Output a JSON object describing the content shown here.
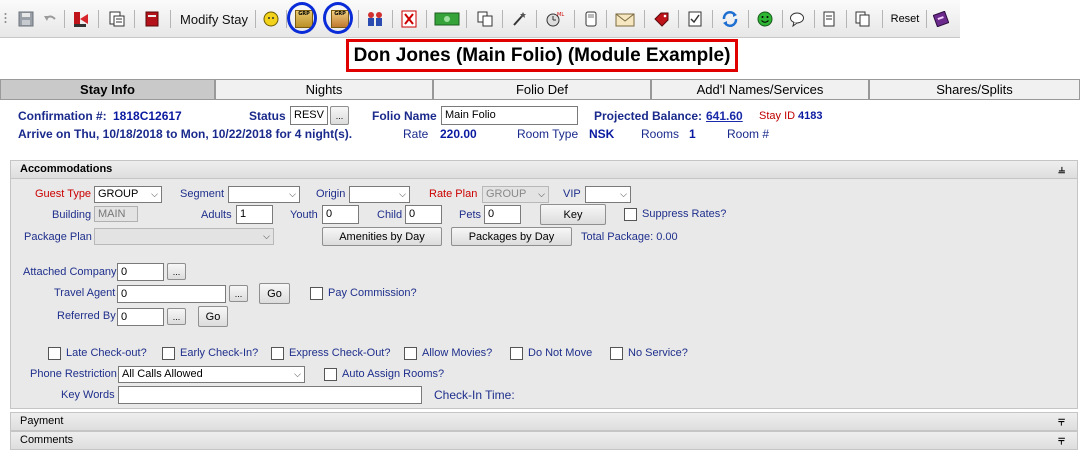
{
  "toolbar": {
    "modify_stay_label": "Modify Stay",
    "grp1_text": "GRP",
    "grp2_text": "GRP",
    "reset_label": "Reset"
  },
  "title": "Don Jones (Main Folio) (Module Example)",
  "tabs": [
    "Stay Info",
    "Nights",
    "Folio Def",
    "Add'l Names/Services",
    "Shares/Splits"
  ],
  "info": {
    "confirmation_label": "Confirmation #:",
    "confirmation_value": "1818C12617",
    "status_label": "Status",
    "status_value": "RESV",
    "folio_name_label": "Folio Name",
    "folio_name_value": "Main Folio",
    "projected_balance_label": "Projected Balance:",
    "projected_balance_value": "641.60",
    "stay_id_label": "Stay ID",
    "stay_id_value": "4183",
    "arrive_text": "Arrive on Thu, 10/18/2018 to Mon, 10/22/2018 for 4 night(s).",
    "rate_label": "Rate",
    "rate_value": "220.00",
    "room_type_label": "Room Type",
    "room_type_value": "NSK",
    "rooms_label": "Rooms",
    "rooms_value": "1",
    "room_num_label": "Room #"
  },
  "accommodations": {
    "header": "Accommodations",
    "guest_type_label": "Guest Type",
    "guest_type_value": "GROUP",
    "segment_label": "Segment",
    "segment_value": "",
    "origin_label": "Origin",
    "origin_value": "",
    "rate_plan_label": "Rate Plan",
    "rate_plan_value": "GROUP",
    "vip_label": "VIP",
    "vip_value": "",
    "building_label": "Building",
    "building_value": "MAIN",
    "adults_label": "Adults",
    "adults_value": "1",
    "youth_label": "Youth",
    "youth_value": "0",
    "child_label": "Child",
    "child_value": "0",
    "pets_label": "Pets",
    "pets_value": "0",
    "key_button": "Key",
    "suppress_rates_label": "Suppress Rates?",
    "package_plan_label": "Package Plan",
    "package_plan_value": "",
    "amenities_button": "Amenities by Day",
    "packages_button": "Packages by Day",
    "total_package_label": "Total Package: 0.00",
    "attached_company_label": "Attached Company",
    "attached_company_value": "0",
    "travel_agent_label": "Travel Agent",
    "travel_agent_value": "0",
    "pay_commission_label": "Pay Commission?",
    "referred_by_label": "Referred By",
    "referred_by_value": "0",
    "go_label": "Go",
    "ellipsis_label": "...",
    "checkboxes": [
      "Late Check-out?",
      "Early Check-In?",
      "Express Check-Out?",
      "Allow Movies?",
      "Do Not Move",
      "No Service?"
    ],
    "phone_restriction_label": "Phone Restriction",
    "phone_restriction_value": "All Calls Allowed",
    "auto_assign_label": "Auto Assign Rooms?",
    "key_words_label": "Key Words",
    "key_words_value": "",
    "checkin_time_label": "Check-In Time:"
  },
  "payment_header": "Payment",
  "comments_header": "Comments"
}
